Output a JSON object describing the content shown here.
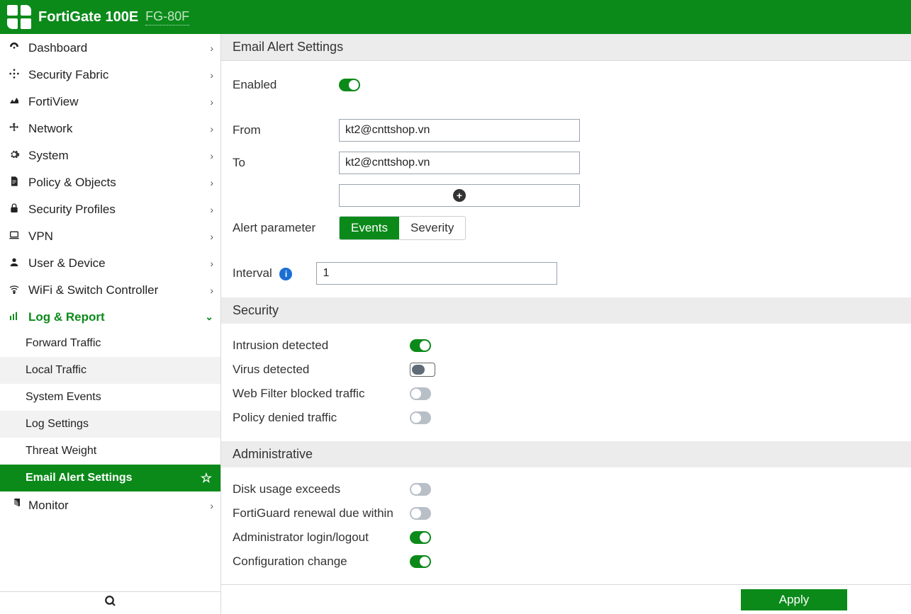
{
  "header": {
    "product": "FortiGate 100E",
    "model": "FG-80F"
  },
  "sidebar": {
    "items": [
      {
        "label": "Dashboard",
        "icon": "dashboard"
      },
      {
        "label": "Security Fabric",
        "icon": "fabric"
      },
      {
        "label": "FortiView",
        "icon": "area-chart"
      },
      {
        "label": "Network",
        "icon": "move"
      },
      {
        "label": "System",
        "icon": "gear"
      },
      {
        "label": "Policy & Objects",
        "icon": "doc"
      },
      {
        "label": "Security Profiles",
        "icon": "lock"
      },
      {
        "label": "VPN",
        "icon": "laptop"
      },
      {
        "label": "User & Device",
        "icon": "user"
      },
      {
        "label": "WiFi & Switch Controller",
        "icon": "wifi"
      },
      {
        "label": "Log & Report",
        "icon": "bars",
        "open": true,
        "children": [
          {
            "label": "Forward Traffic"
          },
          {
            "label": "Local Traffic"
          },
          {
            "label": "System Events"
          },
          {
            "label": "Log Settings"
          },
          {
            "label": "Threat Weight"
          },
          {
            "label": "Email Alert Settings",
            "active": true
          }
        ]
      },
      {
        "label": "Monitor",
        "icon": "pie"
      }
    ]
  },
  "page": {
    "title": "Email Alert Settings",
    "enabled_label": "Enabled",
    "enabled": true,
    "from_label": "From",
    "from_value": "kt2@cnttshop.vn",
    "to_label": "To",
    "to_value": "kt2@cnttshop.vn",
    "alert_param_label": "Alert parameter",
    "alert_param_options": [
      "Events",
      "Severity"
    ],
    "alert_param_selected": "Events",
    "interval_label": "Interval",
    "interval_value": "1",
    "security_header": "Security",
    "security_opts": [
      {
        "label": "Intrusion detected",
        "on": true,
        "style": "normal"
      },
      {
        "label": "Virus detected",
        "on": false,
        "style": "boxed"
      },
      {
        "label": "Web Filter blocked traffic",
        "on": false,
        "style": "normal"
      },
      {
        "label": "Policy denied traffic",
        "on": false,
        "style": "normal"
      }
    ],
    "admin_header": "Administrative",
    "admin_opts": [
      {
        "label": "Disk usage exceeds",
        "on": false
      },
      {
        "label": "FortiGuard renewal due within",
        "on": false
      },
      {
        "label": "Administrator login/logout",
        "on": true
      },
      {
        "label": "Configuration change",
        "on": true
      }
    ],
    "apply_label": "Apply"
  }
}
